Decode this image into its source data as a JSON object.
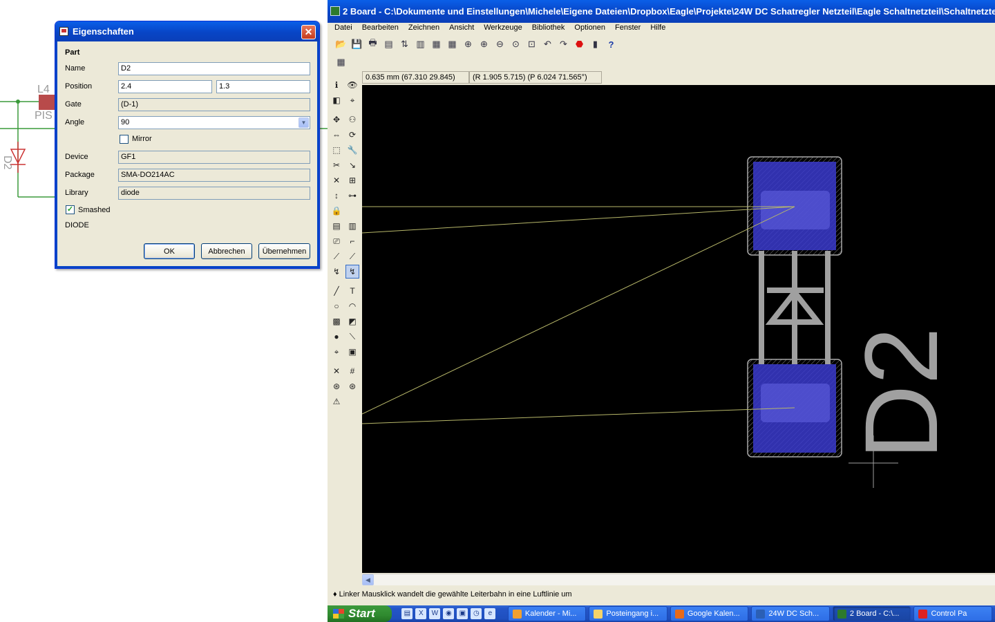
{
  "schematic": {
    "part_label": "L4",
    "part_value": "PIS",
    "diode_label": "D2"
  },
  "dialog": {
    "title": "Eigenschaften",
    "section": "Part",
    "fields": {
      "name_label": "Name",
      "name_value": "D2",
      "position_label": "Position",
      "position_x": "2.4",
      "position_y": "1.3",
      "gate_label": "Gate",
      "gate_value": "(D-1)",
      "angle_label": "Angle",
      "angle_value": "90",
      "mirror_label": "Mirror",
      "mirror_checked": false,
      "device_label": "Device",
      "device_value": "GF1",
      "package_label": "Package",
      "package_value": "SMA-DO214AC",
      "library_label": "Library",
      "library_value": "diode",
      "smashed_label": "Smashed",
      "smashed_checked": true,
      "description": "DIODE"
    },
    "buttons": {
      "ok": "OK",
      "cancel": "Abbrechen",
      "apply": "Übernehmen"
    }
  },
  "eagle": {
    "title": "2 Board - C:\\Dokumente und Einstellungen\\Michele\\Eigene Dateien\\Dropbox\\Eagle\\Projekte\\24W DC Schatregler Netzteil\\Eagle Schaltnetzteil\\Schaltnetzteil",
    "menu": [
      "Datei",
      "Bearbeiten",
      "Zeichnen",
      "Ansicht",
      "Werkzeuge",
      "Bibliothek",
      "Optionen",
      "Fenster",
      "Hilfe"
    ],
    "coord_grid": "0.635 mm (67.310 29.845)",
    "coord_polar": "(R 1.905 5.715) (P 6.024 71.565°)",
    "status_text": "♦ Linker Mausklick wandelt die gewählte Leiterbahn in eine Luftlinie um",
    "canvas_label": "D2",
    "colors": {
      "pad": "#3a3acc",
      "silk": "#a0a0a0",
      "airwire": "#b8b86a",
      "canvas": "#000000"
    }
  },
  "taskbar": {
    "start": "Start",
    "tasks": [
      {
        "label": "Kalender - Mi...",
        "color": "#f0a030"
      },
      {
        "label": "Posteingang i...",
        "color": "#f5d36a"
      },
      {
        "label": "Google Kalen...",
        "color": "#e86a1a"
      },
      {
        "label": "24W DC Sch...",
        "color": "#2b5fb5"
      },
      {
        "label": "2 Board - C:\\...",
        "color": "#2d7a2d"
      },
      {
        "label": "Control Pa",
        "color": "#d22"
      }
    ]
  }
}
